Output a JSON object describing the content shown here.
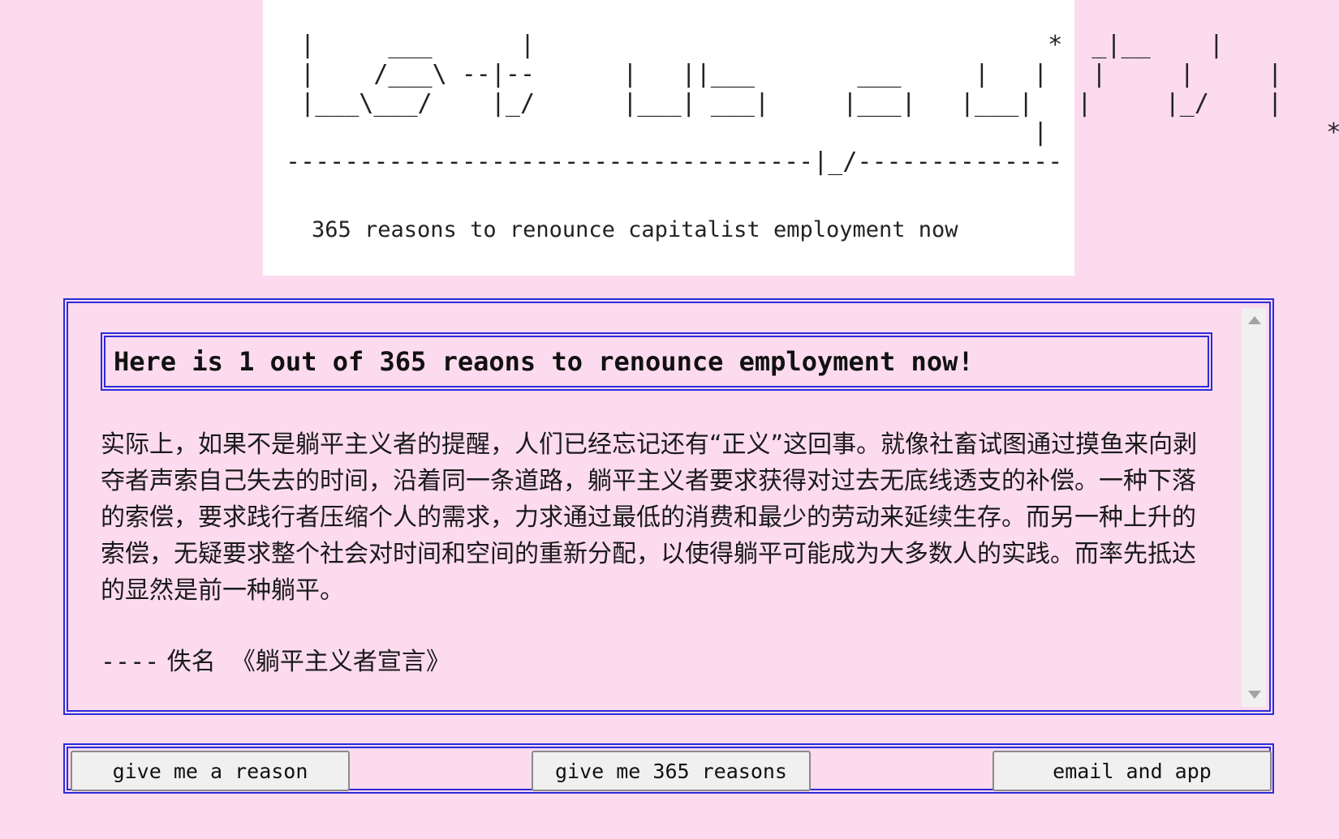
{
  "banner": {
    "ascii_title": " |     ___      |                                   *  _|__    |\n |    /___\\ --|--      |   ||___       ___     |   |   |     |     |\n |___\\___/    |_/      |___| ___|     |___|   |___|   |     |_/    |\n                                                   |                   *\n------------------------------------|_/--------------",
    "tagline": "365 reasons to renounce capitalist employment now"
  },
  "reason_panel": {
    "heading": "Here is 1 out of 365 reaons to renounce employment now!",
    "text": "实际上，如果不是躺平主义者的提醒，人们已经忘记还有“正义”这回事。就像社畜试图通过摸鱼来向剥夺者声索自己失去的时间，沿着同一条道路，躺平主义者要求获得对过去无底线透支的补偿。一种下落的索偿，要求践行者压缩个人的需求，力求通过最低的消费和最少的劳动来延续生存。而另一种上升的索偿，无疑要求整个社会对时间和空间的重新分配，以使得躺平可能成为大多数人的实践。而率先抵达的显然是前一种躺平。",
    "attribution_dash": "----",
    "attribution_author": "佚名",
    "attribution_source": "《躺平主义者宣言》"
  },
  "buttons": {
    "give_reason": "give me a reason",
    "give_365": "give me 365 reasons",
    "email_app": "email and app"
  },
  "colors": {
    "background": "#fddbee",
    "border": "#2b2bd9",
    "banner": "#ffffff",
    "button": "#f0f0f0"
  },
  "icons": [
    "scroll-up-arrow-icon",
    "scroll-down-arrow-icon"
  ]
}
